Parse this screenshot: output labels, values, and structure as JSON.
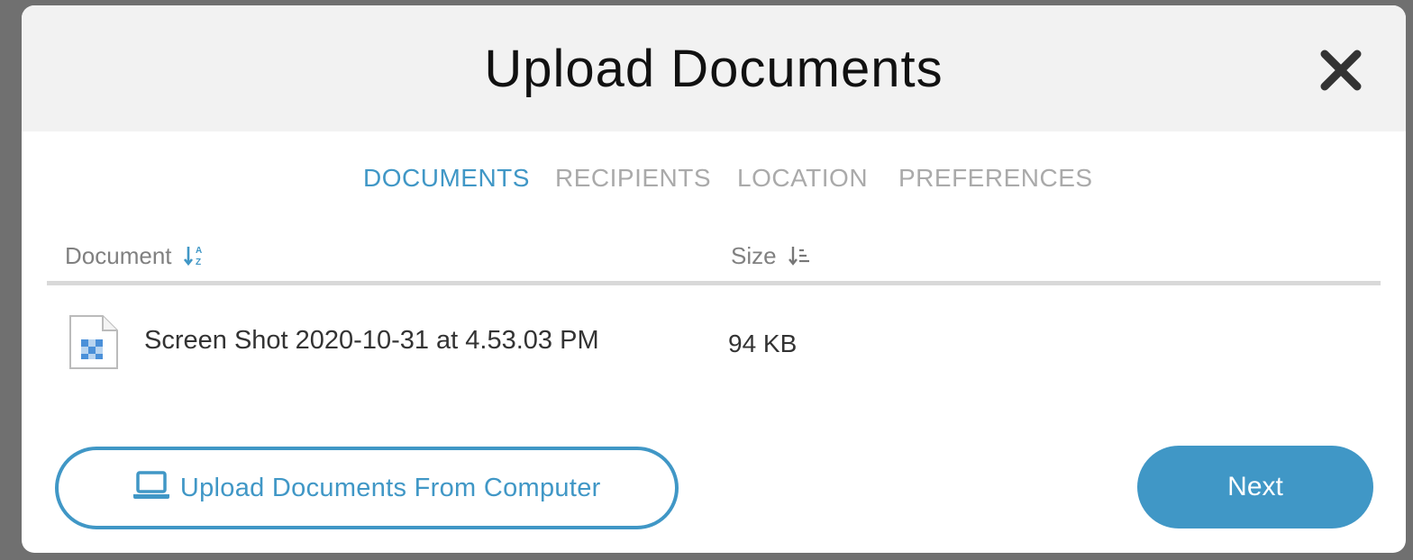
{
  "modal": {
    "title": "Upload Documents",
    "close_icon": "close-icon"
  },
  "tabs": [
    {
      "label": "DOCUMENTS",
      "active": true
    },
    {
      "label": "RECIPIENTS",
      "active": false
    },
    {
      "label": "LOCATION",
      "active": false
    },
    {
      "label": "PREFERENCES",
      "active": false
    }
  ],
  "table": {
    "columns": [
      {
        "label": "Document",
        "sort_icon": "sort-alpha-asc-icon"
      },
      {
        "label": "Size",
        "sort_icon": "sort-amount-icon"
      }
    ],
    "rows": [
      {
        "icon": "image-file-icon",
        "name": "Screen Shot 2020-10-31 at 4.53.03 PM",
        "size": "94 KB"
      }
    ]
  },
  "actions": {
    "upload_label": "Upload Documents From Computer",
    "upload_icon": "laptop-icon",
    "next_label": "Next"
  },
  "colors": {
    "accent": "#4097c6",
    "header_bg": "#f2f2f2",
    "inactive_tab": "#aaaaaa"
  }
}
